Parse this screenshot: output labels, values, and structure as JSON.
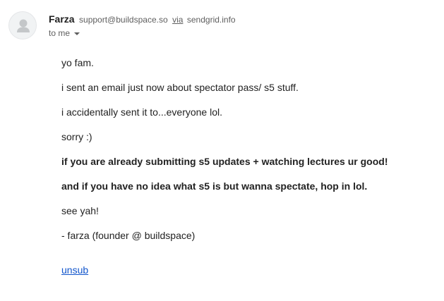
{
  "sender": {
    "name": "Farza",
    "email": "support@buildspace.so",
    "via_label": "via",
    "via_domain": "sendgrid.info",
    "avatar_icon": "person-icon"
  },
  "recipient": {
    "label": "to me",
    "dropdown_icon": "chevron-down-icon"
  },
  "message": {
    "paragraphs": [
      "yo fam.",
      "i sent an email just now about spectator pass/ s5 stuff.",
      "i accidentally sent it to...everyone lol.",
      "sorry :)",
      "if you are already submitting s5 updates + watching lectures ur good!",
      "and if you have no idea what s5 is but wanna spectate, hop in lol.",
      "see yah!",
      "- farza (founder @ buildspace)"
    ],
    "unsubscribe_link": "unsub"
  },
  "colors": {
    "link": "#1155cc",
    "text": "#222222",
    "secondary_text": "#5e5e5e",
    "avatar_bg": "#f1f3f4",
    "avatar_silhouette": "#c4c7c9"
  }
}
